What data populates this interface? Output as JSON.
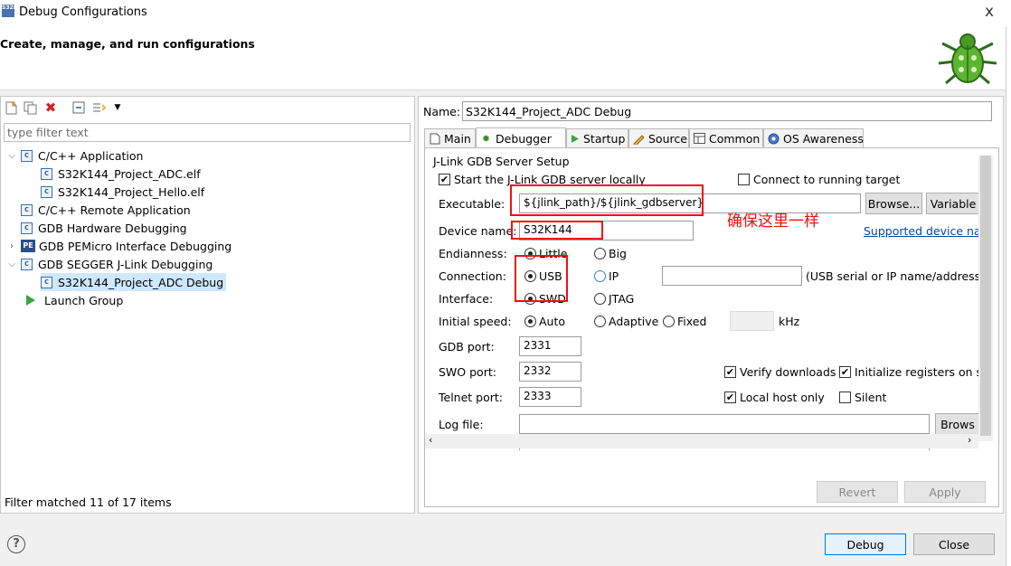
{
  "window": {
    "app_icon_text": "S32DS",
    "title": "Debug Configurations",
    "close_glyph": "x"
  },
  "header": {
    "title": "Create, manage, and run configurations",
    "banner_icon": "bug-icon"
  },
  "left_pane": {
    "toolbar_icons": [
      "new-configuration-icon",
      "duplicate-icon",
      "delete-icon",
      "collapse-all-icon",
      "filter-icon",
      "dropdown-icon"
    ],
    "filter_placeholder": "type filter text",
    "tree": [
      {
        "label": "C/C++ Application",
        "expanded": true,
        "children": [
          "S32K144_Project_ADC.elf",
          "S32K144_Project_Hello.elf"
        ]
      },
      {
        "label": "C/C++ Remote Application"
      },
      {
        "label": "GDB Hardware Debugging"
      },
      {
        "label": "GDB PEMicro Interface Debugging",
        "expanded": false
      },
      {
        "label": "GDB SEGGER J-Link Debugging",
        "expanded": true,
        "children": [
          "S32K144_Project_ADC Debug"
        ],
        "selected": "S32K144_Project_ADC Debug"
      },
      {
        "label": "Launch Group"
      }
    ],
    "status": "Filter matched 11 of 17 items"
  },
  "right_pane": {
    "name_label": "Name:",
    "name_value": "S32K144_Project_ADC Debug",
    "tabs": [
      {
        "label": "Main",
        "icon": "main-tab-icon"
      },
      {
        "label": "Debugger",
        "icon": "debugger-tab-icon",
        "active": true
      },
      {
        "label": "Startup",
        "icon": "startup-tab-icon"
      },
      {
        "label": "Source",
        "icon": "source-tab-icon"
      },
      {
        "label": "Common",
        "icon": "common-tab-icon"
      },
      {
        "label": "OS Awareness",
        "icon": "os-awareness-tab-icon"
      }
    ],
    "group_title": "J-Link GDB Server Setup",
    "start_server_label": "Start the J-Link GDB server locally",
    "start_server_checked": true,
    "connect_running_label": "Connect to running target",
    "connect_running_checked": false,
    "executable_label": "Executable:",
    "executable_value": "${jlink_path}/${jlink_gdbserver}",
    "browse_label": "Browse...",
    "variables_label": "Variable",
    "device_label": "Device name:",
    "device_value": "S32K144",
    "supported_devices_link": "Supported device nar",
    "annotation": "确保这里一样",
    "endianness_label": "Endianness:",
    "endianness_options": [
      "Little",
      "Big"
    ],
    "endianness_selected": "Little",
    "connection_label": "Connection:",
    "connection_options": [
      "USB",
      "IP"
    ],
    "connection_selected": "USB",
    "connection_hint": "(USB serial or IP name/address)",
    "interface_label": "Interface:",
    "interface_options": [
      "SWD",
      "JTAG"
    ],
    "interface_selected": "SWD",
    "speed_label": "Initial speed:",
    "speed_options": [
      "Auto",
      "Adaptive",
      "Fixed"
    ],
    "speed_selected": "Auto",
    "speed_unit": "kHz",
    "gdb_port_label": "GDB port:",
    "gdb_port_value": "2331",
    "swo_port_label": "SWO port:",
    "swo_port_value": "2332",
    "telnet_port_label": "Telnet port:",
    "telnet_port_value": "2333",
    "verify_downloads_label": "Verify downloads",
    "verify_downloads_checked": true,
    "init_registers_label": "Initialize registers on st",
    "init_registers_checked": true,
    "local_host_label": "Local host only",
    "local_host_checked": true,
    "silent_label": "Silent",
    "silent_checked": false,
    "log_file_label": "Log file:",
    "log_file_value": "",
    "log_browse_label": "Brows",
    "revert_label": "Revert",
    "apply_label": "Apply"
  },
  "footer": {
    "help_glyph": "?",
    "debug_label": "Debug",
    "close_label": "Close"
  },
  "colors": {
    "annotation_red": "#ee1111",
    "selection_blue": "#cde8ff",
    "link_blue": "#0645ad"
  }
}
